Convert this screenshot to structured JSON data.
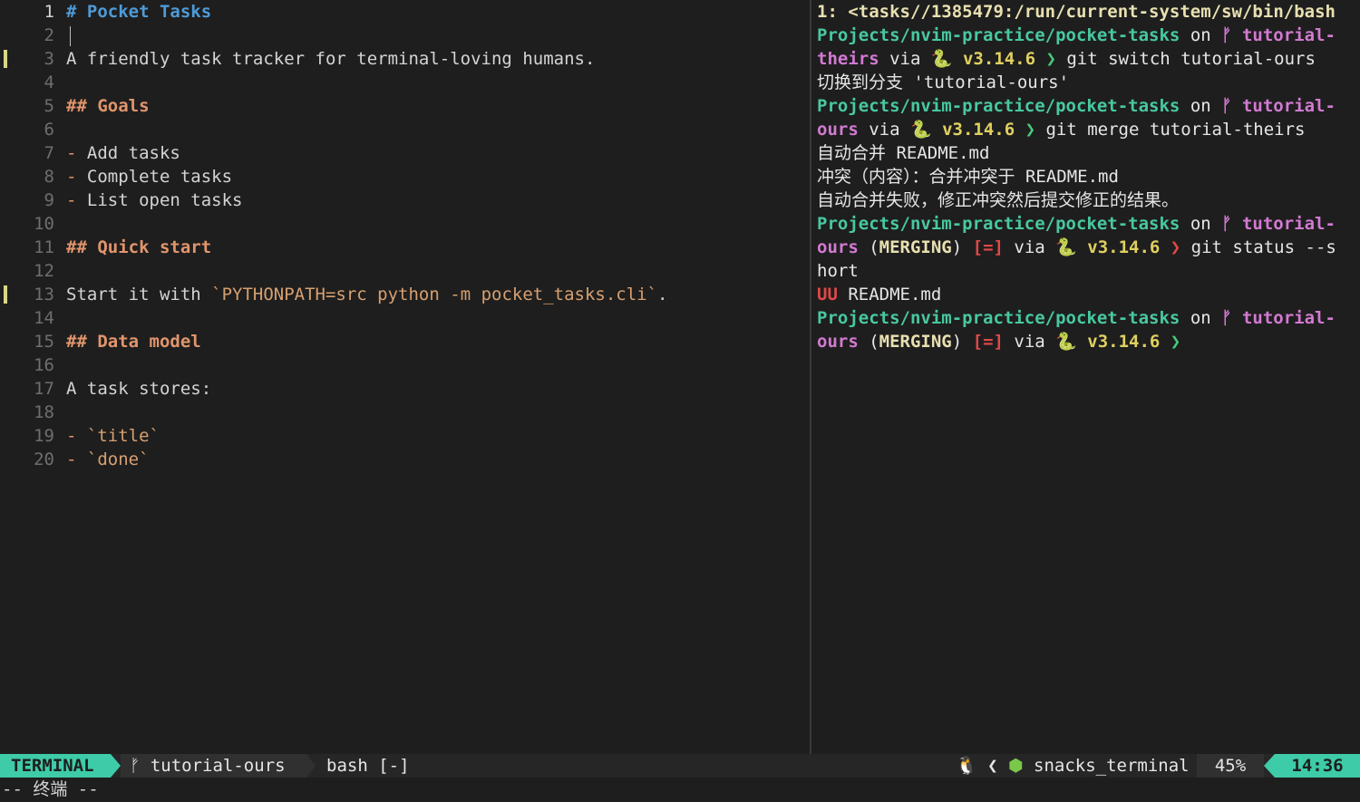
{
  "editor": {
    "lines": [
      {
        "n": "1",
        "parts": [
          [
            "h1",
            "# Pocket Tasks"
          ]
        ],
        "cur": true
      },
      {
        "n": "2",
        "parts": [],
        "cursor": true
      },
      {
        "n": "3",
        "parts": [
          [
            "",
            "A friendly task tracker for terminal-loving humans."
          ]
        ],
        "mark": true
      },
      {
        "n": "4",
        "parts": []
      },
      {
        "n": "5",
        "parts": [
          [
            "h2",
            "## Goals"
          ]
        ]
      },
      {
        "n": "6",
        "parts": []
      },
      {
        "n": "7",
        "parts": [
          [
            "dash",
            "-"
          ],
          [
            "",
            " Add tasks"
          ]
        ]
      },
      {
        "n": "8",
        "parts": [
          [
            "dash",
            "-"
          ],
          [
            "",
            " Complete tasks"
          ]
        ]
      },
      {
        "n": "9",
        "parts": [
          [
            "dash",
            "-"
          ],
          [
            "",
            " List open tasks"
          ]
        ]
      },
      {
        "n": "10",
        "parts": []
      },
      {
        "n": "11",
        "parts": [
          [
            "h2",
            "## Quick start"
          ]
        ]
      },
      {
        "n": "12",
        "parts": []
      },
      {
        "n": "13",
        "parts": [
          [
            "",
            "Start it with "
          ],
          [
            "codespan",
            "`PYTHONPATH=src python -m pocket_tasks.cli`"
          ],
          [
            "",
            "."
          ]
        ],
        "mark": true
      },
      {
        "n": "14",
        "parts": []
      },
      {
        "n": "15",
        "parts": [
          [
            "h2",
            "## Data model"
          ]
        ]
      },
      {
        "n": "16",
        "parts": []
      },
      {
        "n": "17",
        "parts": [
          [
            "",
            "A task stores:"
          ]
        ]
      },
      {
        "n": "18",
        "parts": []
      },
      {
        "n": "19",
        "parts": [
          [
            "dash",
            "-"
          ],
          [
            "",
            " "
          ],
          [
            "codespan",
            "`title`"
          ]
        ]
      },
      {
        "n": "20",
        "parts": [
          [
            "dash",
            "-"
          ],
          [
            "",
            " "
          ],
          [
            "codespan",
            "`done`"
          ]
        ]
      }
    ]
  },
  "terminal": {
    "lines": [
      [
        [
          "wb",
          "1: <tasks//1385479:/run/current-system/sw/bin/bash"
        ]
      ],
      [
        [
          "teal",
          "Projects/nvim-practice/pocket-tasks"
        ],
        [
          "white",
          " on "
        ],
        [
          "pink",
          "ᚠ tutorial-"
        ]
      ],
      [
        [
          "pink",
          "theirs"
        ],
        [
          "white",
          " via "
        ],
        [
          "grn",
          "🐍 "
        ],
        [
          "yel",
          "v3.14.6"
        ],
        [
          "grn",
          " ❯ "
        ],
        [
          "white",
          "git switch tutorial-ours"
        ]
      ],
      [
        [
          "white",
          "切换到分支 'tutorial-ours'"
        ]
      ],
      [
        [
          "teal",
          "Projects/nvim-practice/pocket-tasks"
        ],
        [
          "white",
          " on "
        ],
        [
          "pink",
          "ᚠ tutorial-"
        ]
      ],
      [
        [
          "pink",
          "ours"
        ],
        [
          "white",
          " via "
        ],
        [
          "grn",
          "🐍 "
        ],
        [
          "yel",
          "v3.14.6"
        ],
        [
          "grn",
          " ❯ "
        ],
        [
          "white",
          "git merge tutorial-theirs"
        ]
      ],
      [
        [
          "white",
          "自动合并 README.md"
        ]
      ],
      [
        [
          "white",
          "冲突（内容）：合并冲突于 README.md"
        ]
      ],
      [
        [
          "white",
          "自动合并失败，修正冲突然后提交修正的结果。"
        ]
      ],
      [
        [
          "teal",
          "Projects/nvim-practice/pocket-tasks"
        ],
        [
          "white",
          " on "
        ],
        [
          "pink",
          "ᚠ tutorial-"
        ]
      ],
      [
        [
          "pink",
          "ours"
        ],
        [
          "white",
          " ("
        ],
        [
          "wb",
          "MERGING"
        ],
        [
          "white",
          ") "
        ],
        [
          "red",
          "[=]"
        ],
        [
          "white",
          " via "
        ],
        [
          "grn",
          "🐍 "
        ],
        [
          "yel",
          "v3.14.6"
        ],
        [
          "red",
          " ❯ "
        ],
        [
          "white",
          "git status --s"
        ]
      ],
      [
        [
          "white",
          "hort"
        ]
      ],
      [
        [
          "red",
          "UU"
        ],
        [
          "white",
          " README.md"
        ]
      ],
      [
        [
          "teal",
          "Projects/nvim-practice/pocket-tasks"
        ],
        [
          "white",
          " on "
        ],
        [
          "pink",
          "ᚠ tutorial-"
        ]
      ],
      [
        [
          "pink",
          "ours"
        ],
        [
          "white",
          " ("
        ],
        [
          "wb",
          "MERGING"
        ],
        [
          "white",
          ") "
        ],
        [
          "red",
          "[=]"
        ],
        [
          "white",
          " via "
        ],
        [
          "grn",
          "🐍 "
        ],
        [
          "yel",
          "v3.14.6"
        ],
        [
          "grn",
          " ❯"
        ]
      ]
    ]
  },
  "statusbar": {
    "mode": "TERMINAL",
    "branch_icon": "ᚠ",
    "branch": "tutorial-ours",
    "file": "bash [-]",
    "right_icons": "🐧 ❮ ",
    "filetype_icon": "⬢",
    "filetype": "snacks_terminal",
    "percent": "45%",
    "time": "14:36"
  },
  "cmdline": "-- 终端 --",
  "colors": {
    "accent": "#3ecba8",
    "heading1": "#4e9bd8",
    "heading2": "#e2956c",
    "path": "#48c8a0",
    "branch": "#d27ad2"
  }
}
